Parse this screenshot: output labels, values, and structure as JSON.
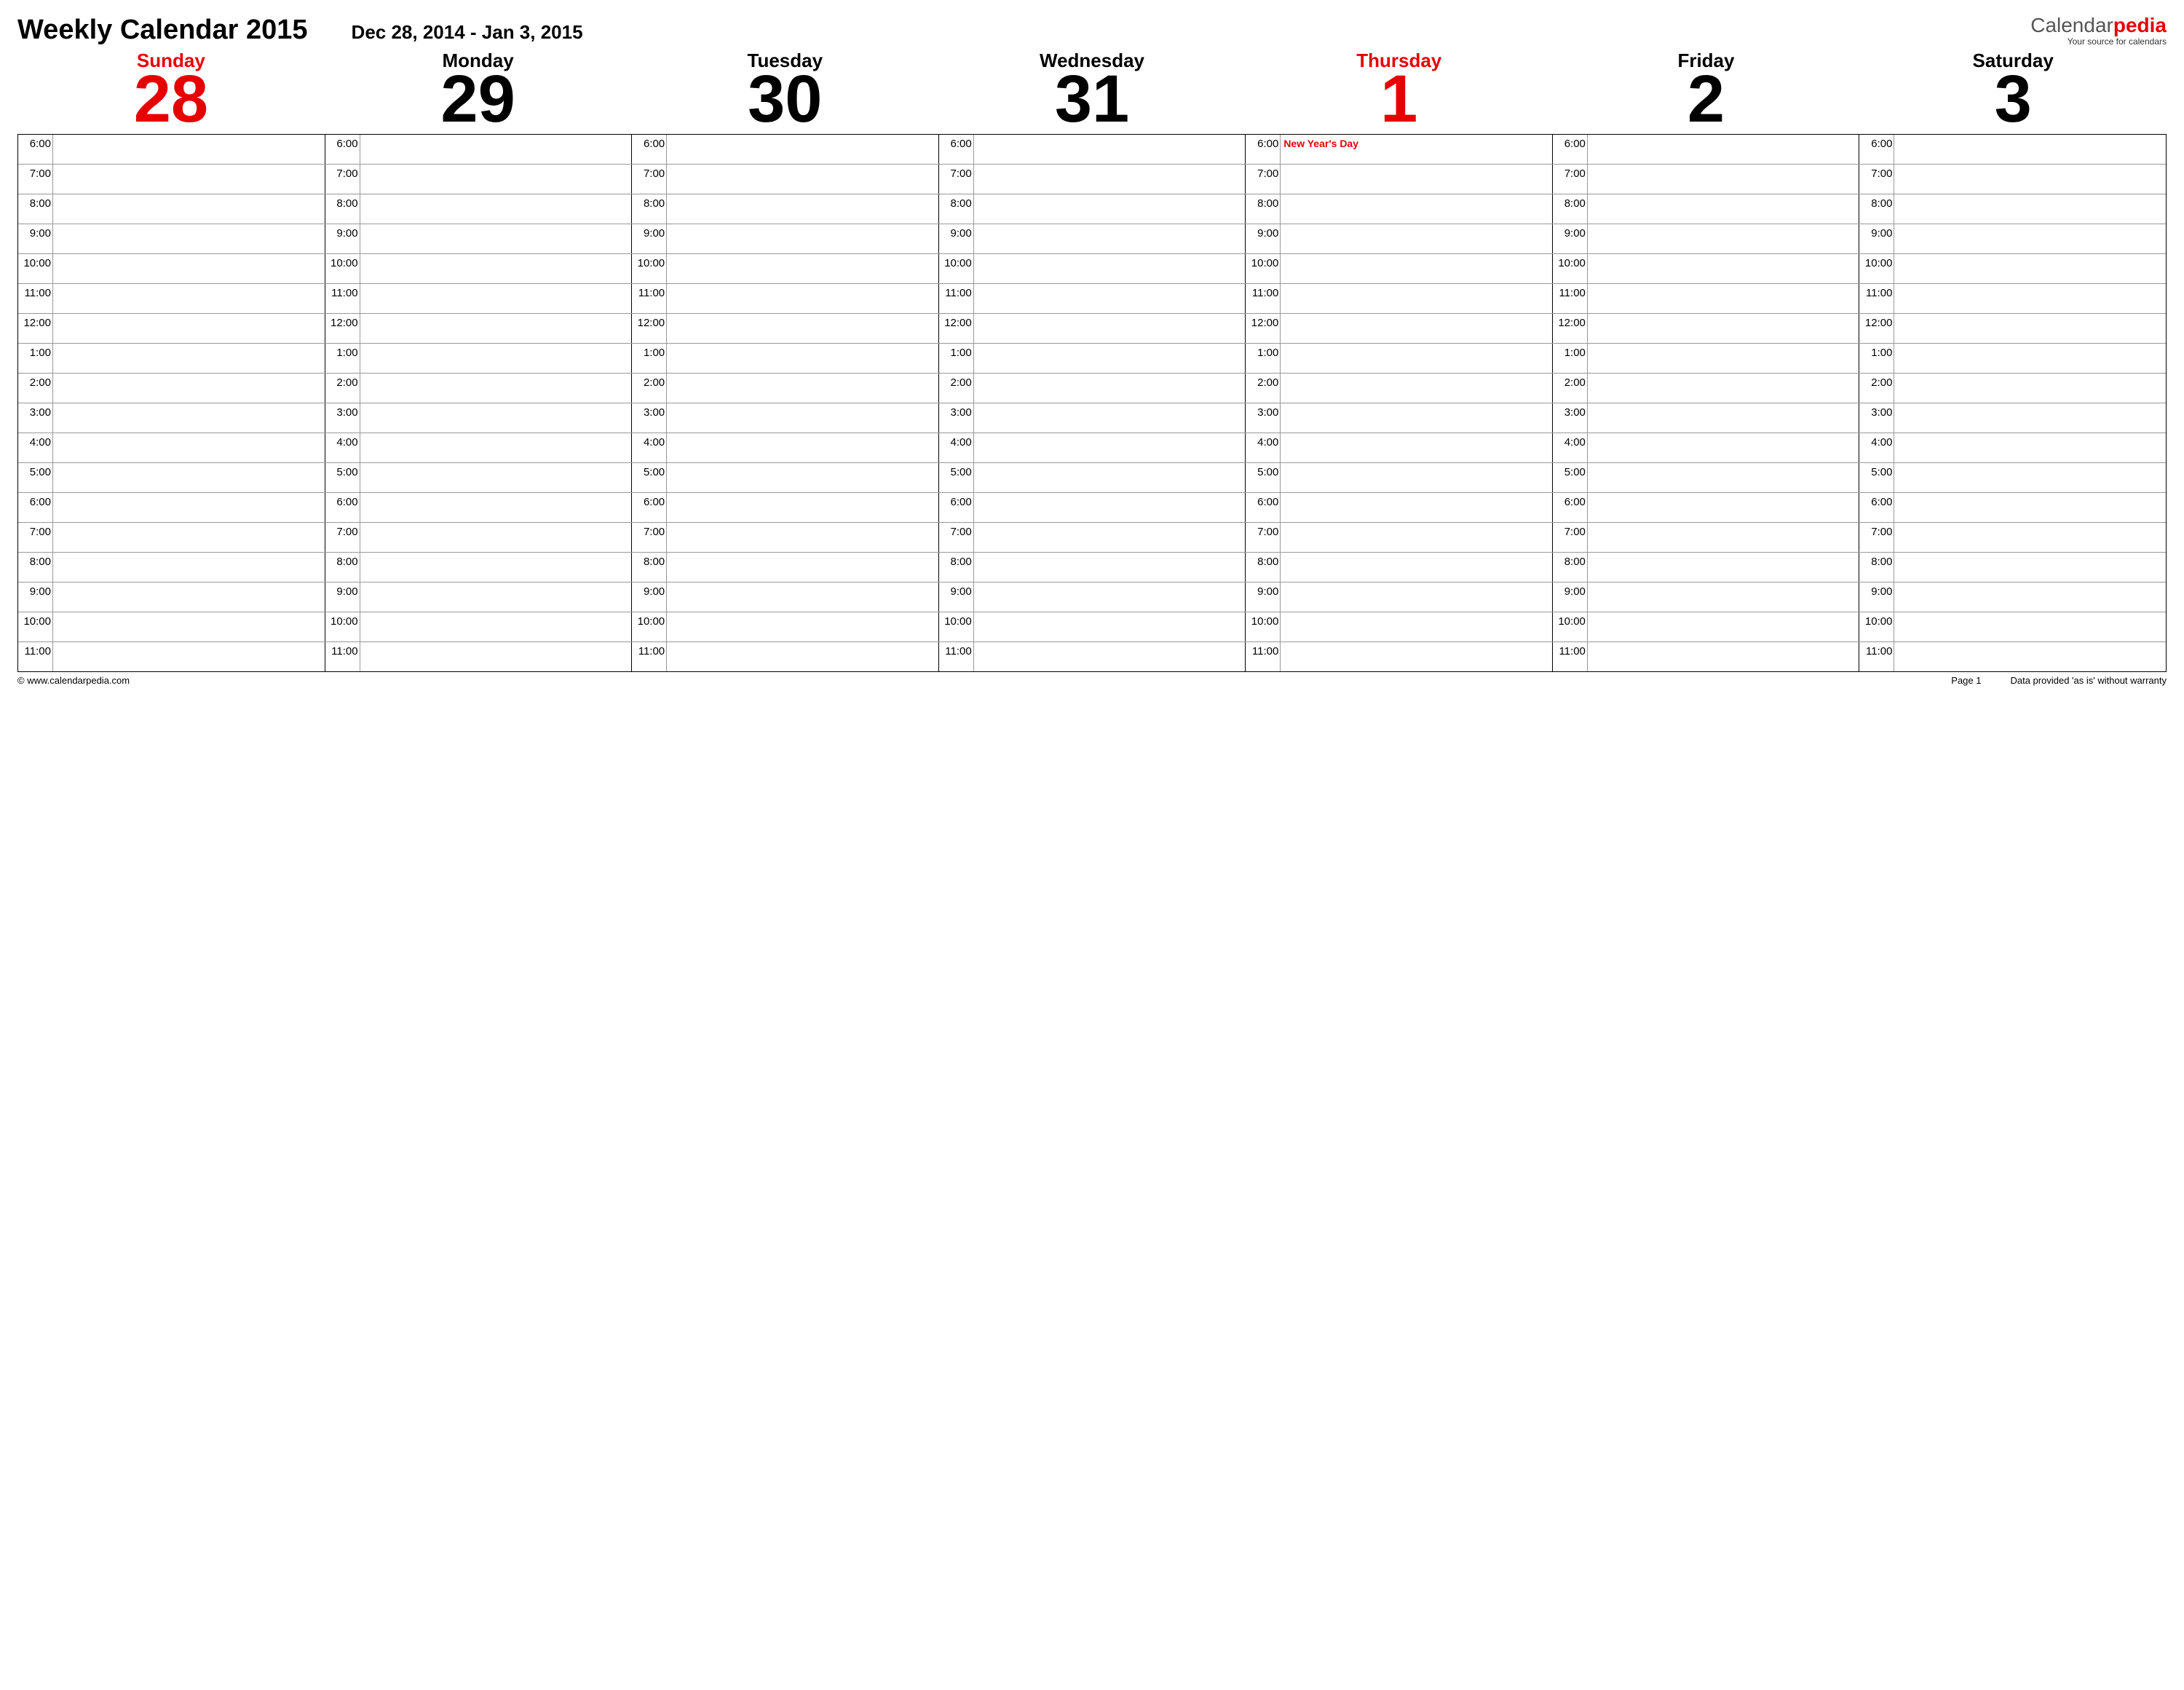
{
  "title": "Weekly Calendar 2015",
  "date_range": "Dec 28, 2014 - Jan 3, 2015",
  "brand": {
    "part1": "Calendar",
    "part2": "pedia",
    "sub": "Your source for calendars"
  },
  "days": [
    {
      "name": "Sunday",
      "num": "28",
      "red": true
    },
    {
      "name": "Monday",
      "num": "29",
      "red": false
    },
    {
      "name": "Tuesday",
      "num": "30",
      "red": false
    },
    {
      "name": "Wednesday",
      "num": "31",
      "red": false
    },
    {
      "name": "Thursday",
      "num": "1",
      "red": true
    },
    {
      "name": "Friday",
      "num": "2",
      "red": false
    },
    {
      "name": "Saturday",
      "num": "3",
      "red": false
    }
  ],
  "hours": [
    "6:00",
    "7:00",
    "8:00",
    "9:00",
    "10:00",
    "11:00",
    "12:00",
    "1:00",
    "2:00",
    "3:00",
    "4:00",
    "5:00",
    "6:00",
    "7:00",
    "8:00",
    "9:00",
    "10:00",
    "11:00"
  ],
  "events": {
    "4": {
      "0": "New Year's Day"
    }
  },
  "footer": {
    "left": "© www.calendarpedia.com",
    "page": "Page 1",
    "right": "Data provided 'as is' without warranty"
  }
}
